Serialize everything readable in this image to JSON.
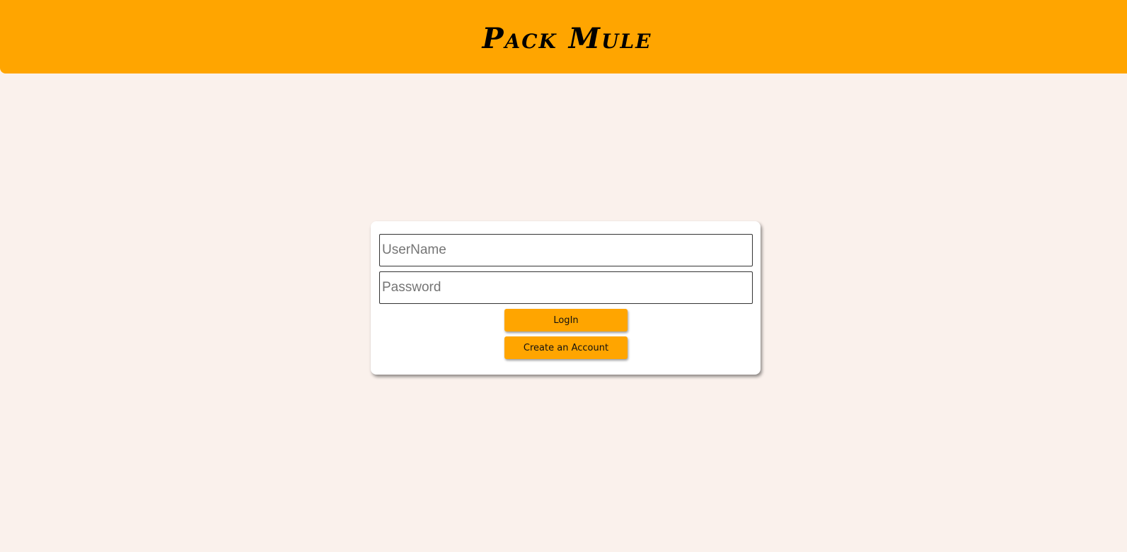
{
  "header": {
    "title": "Pack Mule"
  },
  "login_form": {
    "username_placeholder": "UserName",
    "password_placeholder": "Password",
    "login_label": "LogIn",
    "create_account_label": "Create an Account"
  },
  "colors": {
    "accent": "#ffa500",
    "background": "#faf1ec",
    "card": "#ffffff"
  }
}
